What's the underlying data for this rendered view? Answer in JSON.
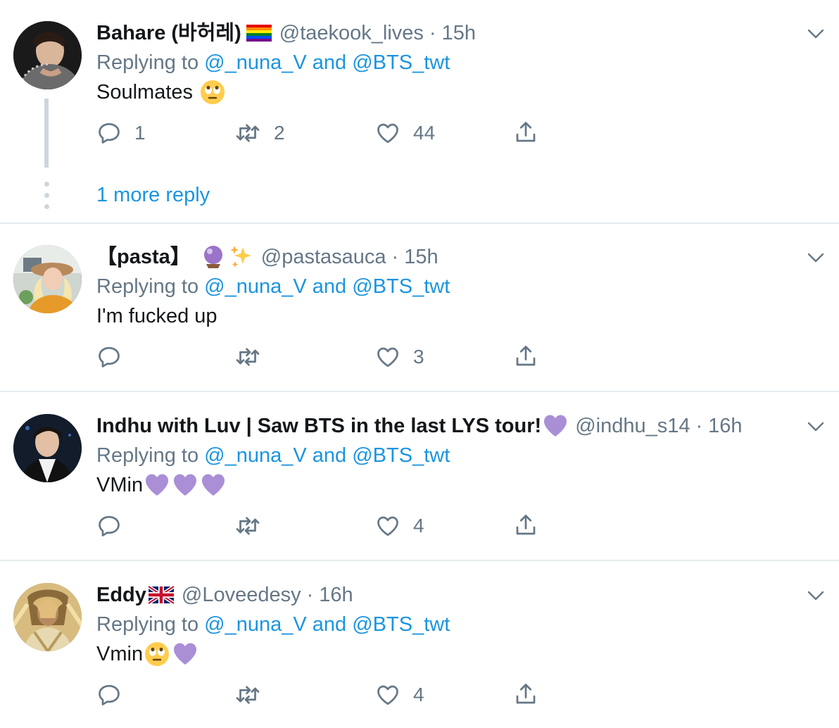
{
  "tweets": [
    {
      "name": "Bahare (바허레)",
      "name_emoji": "rainbow-flag-icon",
      "handle": "@taekook_lives",
      "time": "15h",
      "replying_prefix": "Replying to",
      "reply_user1": "@_nuna_V",
      "reply_and": "and",
      "reply_user2": "@BTS_twt",
      "text": "Soulmates",
      "text_emoji": "face-with-rolling-eyes-icon",
      "reply_count": "1",
      "retweet_count": "2",
      "like_count": "44",
      "more_replies": "1 more reply"
    },
    {
      "name": "【pasta】",
      "name_emoji": "crystal-ball-sparkles-icon",
      "handle": "@pastasauca",
      "time": "15h",
      "replying_prefix": "Replying to",
      "reply_user1": "@_nuna_V",
      "reply_and": "and",
      "reply_user2": "@BTS_twt",
      "text": "I'm fucked up",
      "reply_count": "",
      "retweet_count": "",
      "like_count": "3"
    },
    {
      "name": "Indhu with Luv | Saw BTS in the last LYS tour!",
      "name_emoji": "purple-heart-icon",
      "handle": "@indhu_s14",
      "time": "16h",
      "replying_prefix": "Replying to",
      "reply_user1": "@_nuna_V",
      "reply_and": "and",
      "reply_user2": "@BTS_twt",
      "text": "VMin",
      "text_emoji": "purple-heart-icon x3",
      "reply_count": "",
      "retweet_count": "",
      "like_count": "4"
    },
    {
      "name": "Eddy",
      "name_emoji": "uk-flag-icon",
      "handle": "@Loveedesy",
      "time": "16h",
      "replying_prefix": "Replying to",
      "reply_user1": "@_nuna_V",
      "reply_and": "and",
      "reply_user2": "@BTS_twt",
      "text": "Vmin",
      "text_emoji": "face-with-rolling-eyes-icon, purple-heart-icon",
      "reply_count": "",
      "retweet_count": "",
      "like_count": "4"
    }
  ],
  "separator": "·",
  "colors": {
    "link": "#1b95e0",
    "secondary": "#657786",
    "divider": "#e6ecf0",
    "thread": "#ccd6dd",
    "purple_heart": "#aa8ed6"
  }
}
